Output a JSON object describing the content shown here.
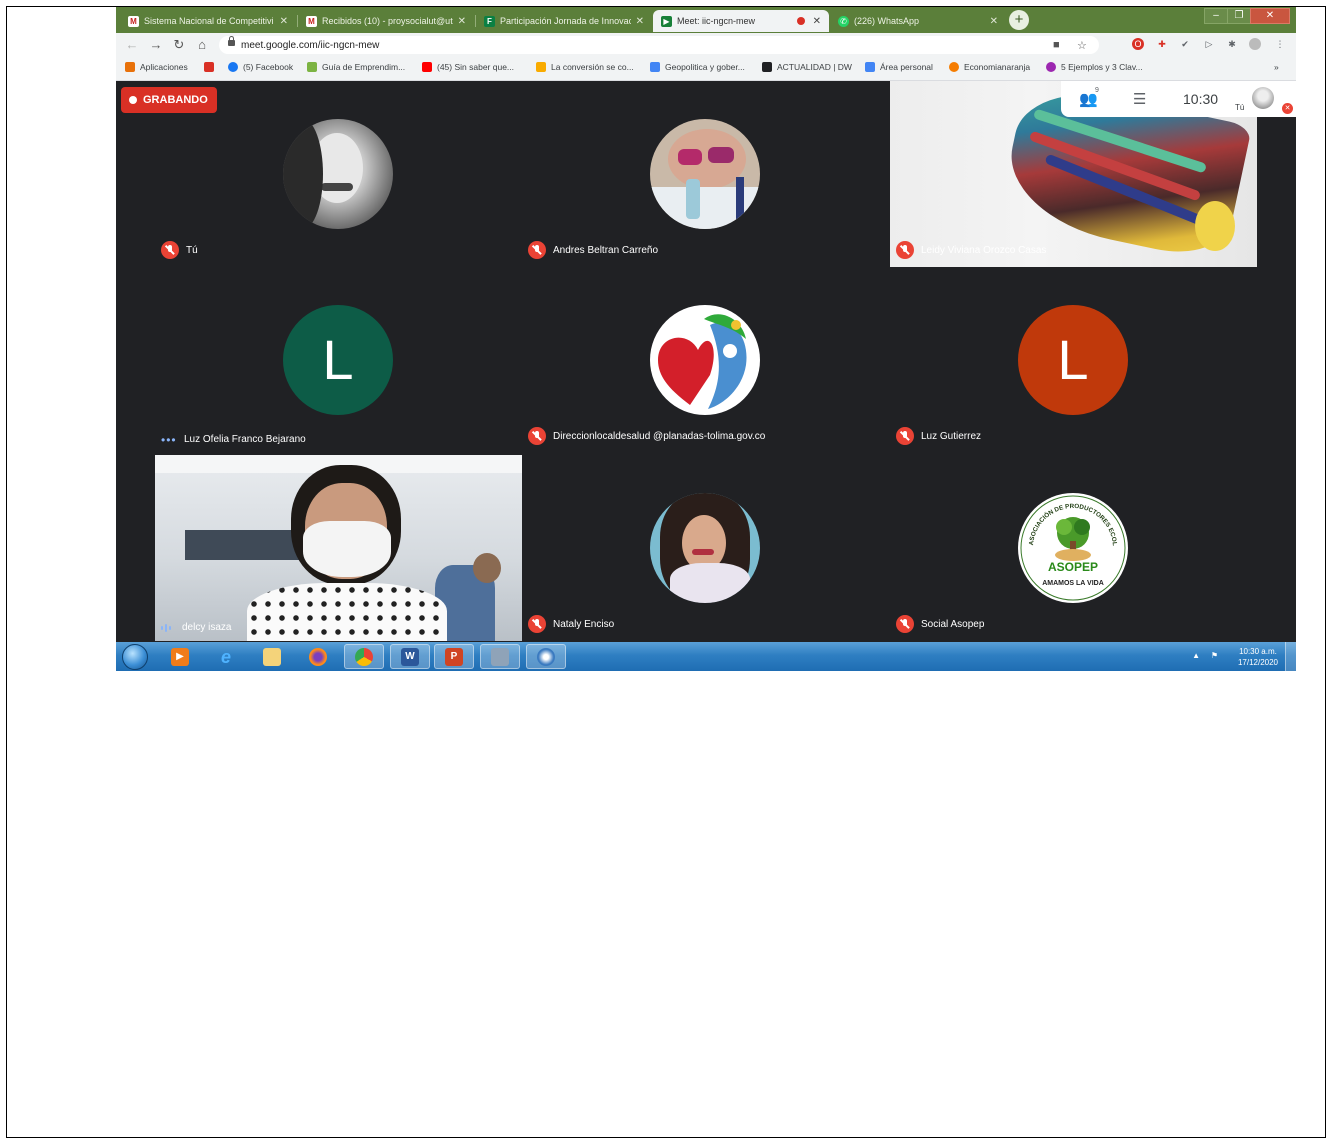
{
  "tabs": [
    {
      "label": "Sistema Nacional de Competitivi",
      "color": "#c5221f",
      "glyph": "M"
    },
    {
      "label": "Recibidos (10) - proysocialut@ut",
      "color": "#c5221f",
      "glyph": "M"
    },
    {
      "label": "Participación Jornada de Innovac",
      "color": "#0b8043",
      "glyph": "F"
    },
    {
      "label": "Meet: iic-ngcn-mew",
      "color": "#188038",
      "glyph": "▶"
    },
    {
      "label": "(226) WhatsApp",
      "color": "#25d366",
      "glyph": "✆"
    }
  ],
  "address": {
    "url": "meet.google.com/iic-ngcn-mew"
  },
  "bookmarks": [
    {
      "label": "Aplicaciones",
      "color": "#e8710a"
    },
    {
      "label": "",
      "color": "#d93025"
    },
    {
      "label": "(5) Facebook",
      "color": "#1877f2"
    },
    {
      "label": "Guía de Emprendim...",
      "color": "#7cb342"
    },
    {
      "label": "(45) Sin saber que...",
      "color": "#ff0000"
    },
    {
      "label": "La conversión se co...",
      "color": "#f9ab00"
    },
    {
      "label": "Geopolitica y gober...",
      "color": "#4285f4"
    },
    {
      "label": "ACTUALIDAD | DW",
      "color": "#202124"
    },
    {
      "label": "Área personal",
      "color": "#4285f4"
    },
    {
      "label": "Economianaranja",
      "color": "#f57c00"
    },
    {
      "label": "5 Ejemplos y 3 Clav...",
      "color": "#9c27b0"
    }
  ],
  "meet": {
    "recording_label": "GRABANDO",
    "clock": "10:30",
    "self_label": "Tú",
    "people_count": "9",
    "participants": [
      {
        "name": "Tú",
        "status": "muted",
        "kind": "photo-bw"
      },
      {
        "name": "Andres Beltran Carreño",
        "status": "muted",
        "kind": "photo-baby"
      },
      {
        "name": "Leidy Viviana Orozco Casas",
        "status": "muted",
        "kind": "video-painting"
      },
      {
        "name": "Luz Ofelia Franco Bejarano",
        "status": "speaking-dots",
        "kind": "letter",
        "letter": "L",
        "bg": "#0d5c47"
      },
      {
        "name": "Direccionlocaldesalud @planadas-tolima.gov.co",
        "status": "muted",
        "kind": "logo-heart"
      },
      {
        "name": "Luz Gutierrez",
        "status": "muted",
        "kind": "letter",
        "letter": "L",
        "bg": "#c0390b"
      },
      {
        "name": "delcy isaza",
        "status": "speaking-bars",
        "kind": "video-person"
      },
      {
        "name": "Nataly Enciso",
        "status": "muted",
        "kind": "photo-woman"
      },
      {
        "name": "Social Asopep",
        "status": "muted",
        "kind": "logo-asopep",
        "logo_text": "ASOPEP",
        "logo_ring": "ASOCIACIÓN DE PRODUCTORES ECOLÓGICOS DE PLANADAS",
        "logo_motto": "AMAMOS LA VIDA"
      }
    ]
  },
  "taskbar": {
    "time": "10:30 a.m.",
    "date": "17/12/2020"
  }
}
